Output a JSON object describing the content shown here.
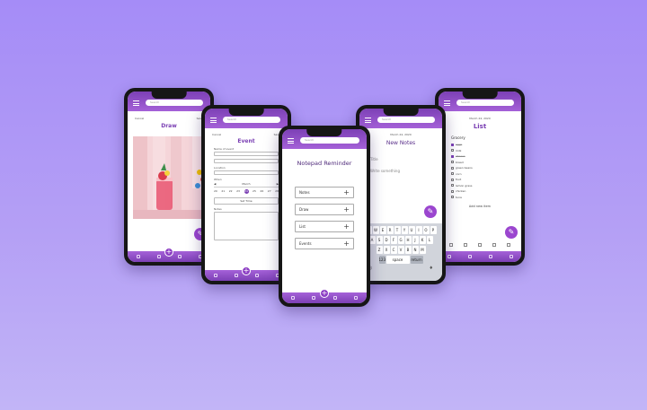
{
  "common": {
    "search_placeholder": "Search",
    "center_add": "+"
  },
  "draw": {
    "cancel": "Cancel",
    "save": "Save",
    "title": "Draw"
  },
  "event": {
    "cancel": "Cancel",
    "save": "Save",
    "title": "Event",
    "name_label": "Name of event",
    "location_label": "Location",
    "when_label": "When",
    "month": "March",
    "days": [
      "20",
      "21",
      "22",
      "23",
      "24",
      "25",
      "26",
      "27",
      "28"
    ],
    "selected_day": "24",
    "set_time": "Set Time",
    "notes_label": "Notes"
  },
  "notepad": {
    "title": "Notepad Reminder",
    "buttons": [
      "Notes",
      "Draw",
      "List",
      "Events"
    ]
  },
  "notes": {
    "date": "March 24, 2020",
    "title": "New Notes",
    "field1": "Title",
    "field2": "Write something",
    "keyboard_rows": [
      [
        "Q",
        "W",
        "E",
        "R",
        "T",
        "Y",
        "U",
        "I",
        "O",
        "P"
      ],
      [
        "A",
        "S",
        "D",
        "F",
        "G",
        "H",
        "J",
        "K",
        "L"
      ],
      [
        "Z",
        "X",
        "C",
        "V",
        "B",
        "N",
        "M"
      ]
    ],
    "space": "space",
    "return": "return"
  },
  "list": {
    "date": "March 24, 2020",
    "title": "List",
    "group": "Grocery",
    "items": [
      {
        "label": "eggs",
        "done": true
      },
      {
        "label": "milk",
        "done": false
      },
      {
        "label": "cheese",
        "done": true
      },
      {
        "label": "bread",
        "done": false
      },
      {
        "label": "green beans",
        "done": false
      },
      {
        "label": "corn",
        "done": false
      },
      {
        "label": "fruit",
        "done": false
      },
      {
        "label": "lemon grass",
        "done": false
      },
      {
        "label": "chicken",
        "done": false
      },
      {
        "label": "tuna",
        "done": false
      }
    ],
    "add_item": "Add new item"
  },
  "colors": {
    "background_top": "#a58cf7",
    "accent": "#7c40b5",
    "accent_light": "#a561d8"
  }
}
